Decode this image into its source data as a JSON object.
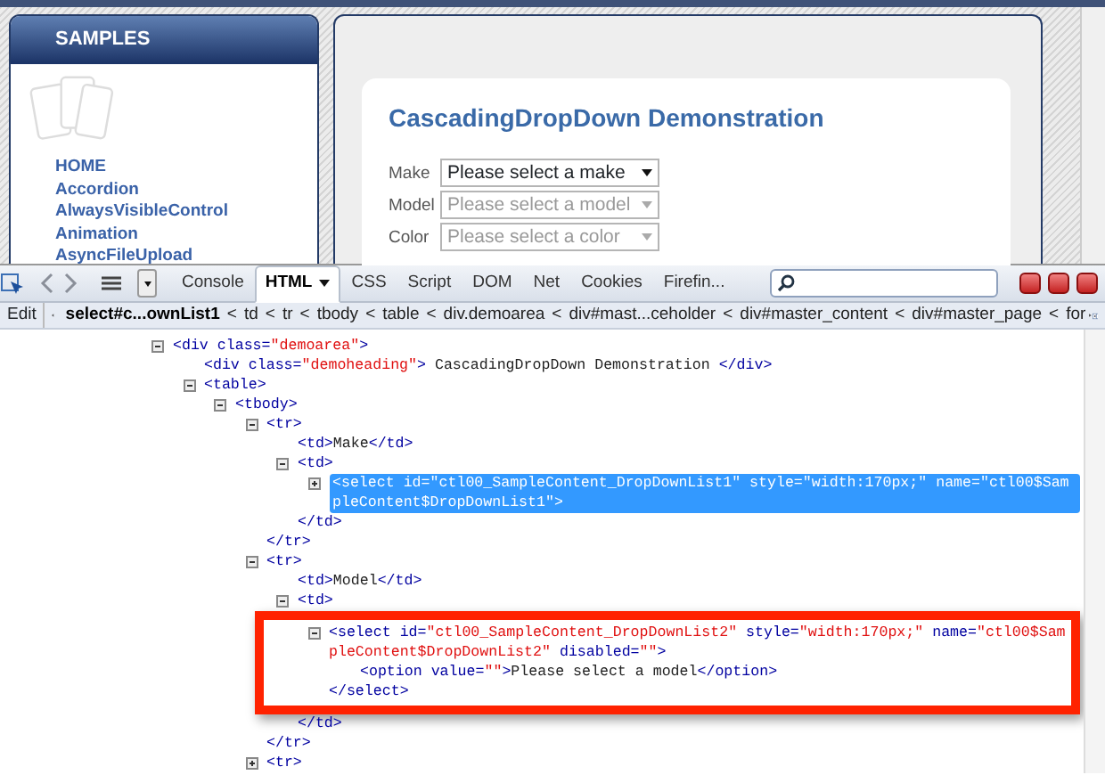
{
  "page": {
    "sidebar": {
      "title": "SAMPLES",
      "links": [
        {
          "label": "HOME"
        },
        {
          "label": "Accordion"
        },
        {
          "label": "AlwaysVisibleControl"
        },
        {
          "label": "Animation"
        },
        {
          "label": "AsyncFileUpload"
        }
      ]
    },
    "demo": {
      "title": "CascadingDropDown Demonstration",
      "fields": [
        {
          "label": "Make",
          "value": "Please select a make",
          "disabled": false
        },
        {
          "label": "Model",
          "value": "Please select a model",
          "disabled": true
        },
        {
          "label": "Color",
          "value": "Please select a color",
          "disabled": true
        }
      ]
    }
  },
  "firebug": {
    "tabs": [
      {
        "label": "Console",
        "selected": false,
        "dropdown": false
      },
      {
        "label": "HTML",
        "selected": true,
        "dropdown": true
      },
      {
        "label": "CSS",
        "selected": false,
        "dropdown": false
      },
      {
        "label": "Script",
        "selected": false,
        "dropdown": false
      },
      {
        "label": "DOM",
        "selected": false,
        "dropdown": false
      },
      {
        "label": "Net",
        "selected": false,
        "dropdown": false
      },
      {
        "label": "Cookies",
        "selected": false,
        "dropdown": false
      },
      {
        "label": "Firefin...",
        "selected": false,
        "dropdown": false
      }
    ],
    "edit_button": "Edit",
    "separator": "<",
    "path": [
      {
        "label": "select#c...ownList1",
        "selected": true
      },
      {
        "label": "td",
        "selected": false
      },
      {
        "label": "tr",
        "selected": false
      },
      {
        "label": "tbody",
        "selected": false
      },
      {
        "label": "table",
        "selected": false
      },
      {
        "label": "div.demoarea",
        "selected": false
      },
      {
        "label": "div#mast...ceholder",
        "selected": false
      },
      {
        "label": "div#master_content",
        "selected": false
      },
      {
        "label": "div#master_page",
        "selected": false
      },
      {
        "label": "for",
        "selected": false
      }
    ],
    "tree": [
      {
        "expandable": true,
        "expanded": true,
        "tokens": [
          {
            "kind": "tag",
            "text": "<div class="
          },
          {
            "kind": "value",
            "text": "\"demoarea\""
          },
          {
            "kind": "tag",
            "text": ">"
          }
        ],
        "children": [
          {
            "expandable": false,
            "tokens": [
              {
                "kind": "tag",
                "text": "<div class="
              },
              {
                "kind": "value",
                "text": "\"demoheading\""
              },
              {
                "kind": "tag",
                "text": ">"
              },
              {
                "kind": "text",
                "text": " CascadingDropDown Demonstration "
              },
              {
                "kind": "tag",
                "text": "</div>"
              }
            ]
          },
          {
            "expandable": true,
            "expanded": true,
            "tokens": [
              {
                "kind": "tag",
                "text": "<table>"
              }
            ],
            "children": [
              {
                "expandable": true,
                "expanded": true,
                "tokens": [
                  {
                    "kind": "tag",
                    "text": "<tbody>"
                  }
                ],
                "children": [
                  {
                    "expandable": true,
                    "expanded": true,
                    "tokens": [
                      {
                        "kind": "tag",
                        "text": "<tr>"
                      }
                    ],
                    "children": [
                      {
                        "expandable": false,
                        "tokens": [
                          {
                            "kind": "tag",
                            "text": "<td>"
                          },
                          {
                            "kind": "text",
                            "text": "Make"
                          },
                          {
                            "kind": "tag",
                            "text": "</td>"
                          }
                        ]
                      },
                      {
                        "expandable": true,
                        "expanded": true,
                        "tokens": [
                          {
                            "kind": "tag",
                            "text": "<td>"
                          }
                        ],
                        "children": [
                          {
                            "expandable": true,
                            "expanded": false,
                            "selected": true,
                            "tokens": [
                              {
                                "kind": "tag",
                                "text": "<select id="
                              },
                              {
                                "kind": "value",
                                "text": "\"ctl00_SampleContent_DropDownList1\""
                              },
                              {
                                "kind": "tag",
                                "text": " style="
                              },
                              {
                                "kind": "value",
                                "text": "\"width:170px;\""
                              },
                              {
                                "kind": "tag",
                                "text": " name="
                              },
                              {
                                "kind": "value",
                                "text": "\"ctl00$SampleContent$DropDownList1\""
                              },
                              {
                                "kind": "tag",
                                "text": ">"
                              }
                            ]
                          }
                        ],
                        "closing": [
                          {
                            "kind": "tag",
                            "text": "</td>"
                          }
                        ]
                      }
                    ],
                    "closing": [
                      {
                        "kind": "tag",
                        "text": "</tr>"
                      }
                    ]
                  },
                  {
                    "expandable": true,
                    "expanded": true,
                    "tokens": [
                      {
                        "kind": "tag",
                        "text": "<tr>"
                      }
                    ],
                    "children": [
                      {
                        "expandable": false,
                        "tokens": [
                          {
                            "kind": "tag",
                            "text": "<td>"
                          },
                          {
                            "kind": "text",
                            "text": "Model"
                          },
                          {
                            "kind": "tag",
                            "text": "</td>"
                          }
                        ]
                      },
                      {
                        "expandable": true,
                        "expanded": true,
                        "tokens": [
                          {
                            "kind": "tag",
                            "text": "<td>"
                          }
                        ],
                        "children": [
                          {
                            "expandable": true,
                            "expanded": true,
                            "highlighted": true,
                            "tokens": [
                              {
                                "kind": "tag",
                                "text": "<select id="
                              },
                              {
                                "kind": "value",
                                "text": "\"ctl00_SampleContent_DropDownList2\""
                              },
                              {
                                "kind": "tag",
                                "text": " style="
                              },
                              {
                                "kind": "value",
                                "text": "\"width:170px;\""
                              },
                              {
                                "kind": "tag",
                                "text": " name="
                              },
                              {
                                "kind": "value",
                                "text": "\"ctl00$SampleContent$DropDownList2\""
                              },
                              {
                                "kind": "tag",
                                "text": " disabled="
                              },
                              {
                                "kind": "value",
                                "text": "\"\""
                              },
                              {
                                "kind": "tag",
                                "text": ">"
                              }
                            ],
                            "children": [
                              {
                                "expandable": false,
                                "tokens": [
                                  {
                                    "kind": "tag",
                                    "text": "<option value="
                                  },
                                  {
                                    "kind": "value",
                                    "text": "\"\""
                                  },
                                  {
                                    "kind": "tag",
                                    "text": ">"
                                  },
                                  {
                                    "kind": "text",
                                    "text": "Please select a model"
                                  },
                                  {
                                    "kind": "tag",
                                    "text": "</option>"
                                  }
                                ]
                              }
                            ],
                            "closing": [
                              {
                                "kind": "tag",
                                "text": "</select>"
                              }
                            ]
                          }
                        ],
                        "closing": [
                          {
                            "kind": "tag",
                            "text": "</td>"
                          }
                        ]
                      }
                    ],
                    "closing": [
                      {
                        "kind": "tag",
                        "text": "</tr>"
                      }
                    ]
                  },
                  {
                    "expandable": true,
                    "expanded": false,
                    "tokens": [
                      {
                        "kind": "tag",
                        "text": "<tr>"
                      }
                    ]
                  }
                ]
              }
            ]
          }
        ]
      }
    ]
  }
}
